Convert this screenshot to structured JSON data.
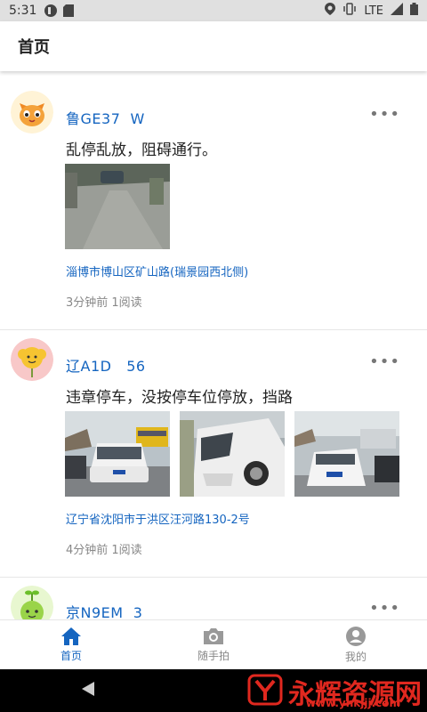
{
  "status": {
    "time": "5:31",
    "network": "LTE"
  },
  "header": {
    "title": "首页"
  },
  "posts": [
    {
      "plate": "鲁GE37  W",
      "description": "乱停乱放，阻碍通行。",
      "address": "淄博市博山区矿山路(瑞景园西北侧)",
      "meta": "3分钟前 1阅读",
      "avatar_icon": "orange-cat-icon",
      "more_label": "•••"
    },
    {
      "plate": "辽A1D   56",
      "description": "违章停车，没按停车位停放，挡路",
      "address": "辽宁省沈阳市于洪区汪河路130-2号",
      "meta": "4分钟前 1阅读",
      "avatar_icon": "yellow-flower-icon",
      "more_label": "•••"
    },
    {
      "plate": "京N9EM  3",
      "avatar_icon": "green-sprout-icon",
      "more_label": "•••"
    }
  ],
  "nav": {
    "home": "首页",
    "camera": "随手拍",
    "profile": "我的"
  },
  "watermark": {
    "text": "永辉资源网",
    "url": "www.yhkjjj.com"
  },
  "colors": {
    "accent": "#1565c0",
    "statusbar": "#e0e0e0"
  }
}
